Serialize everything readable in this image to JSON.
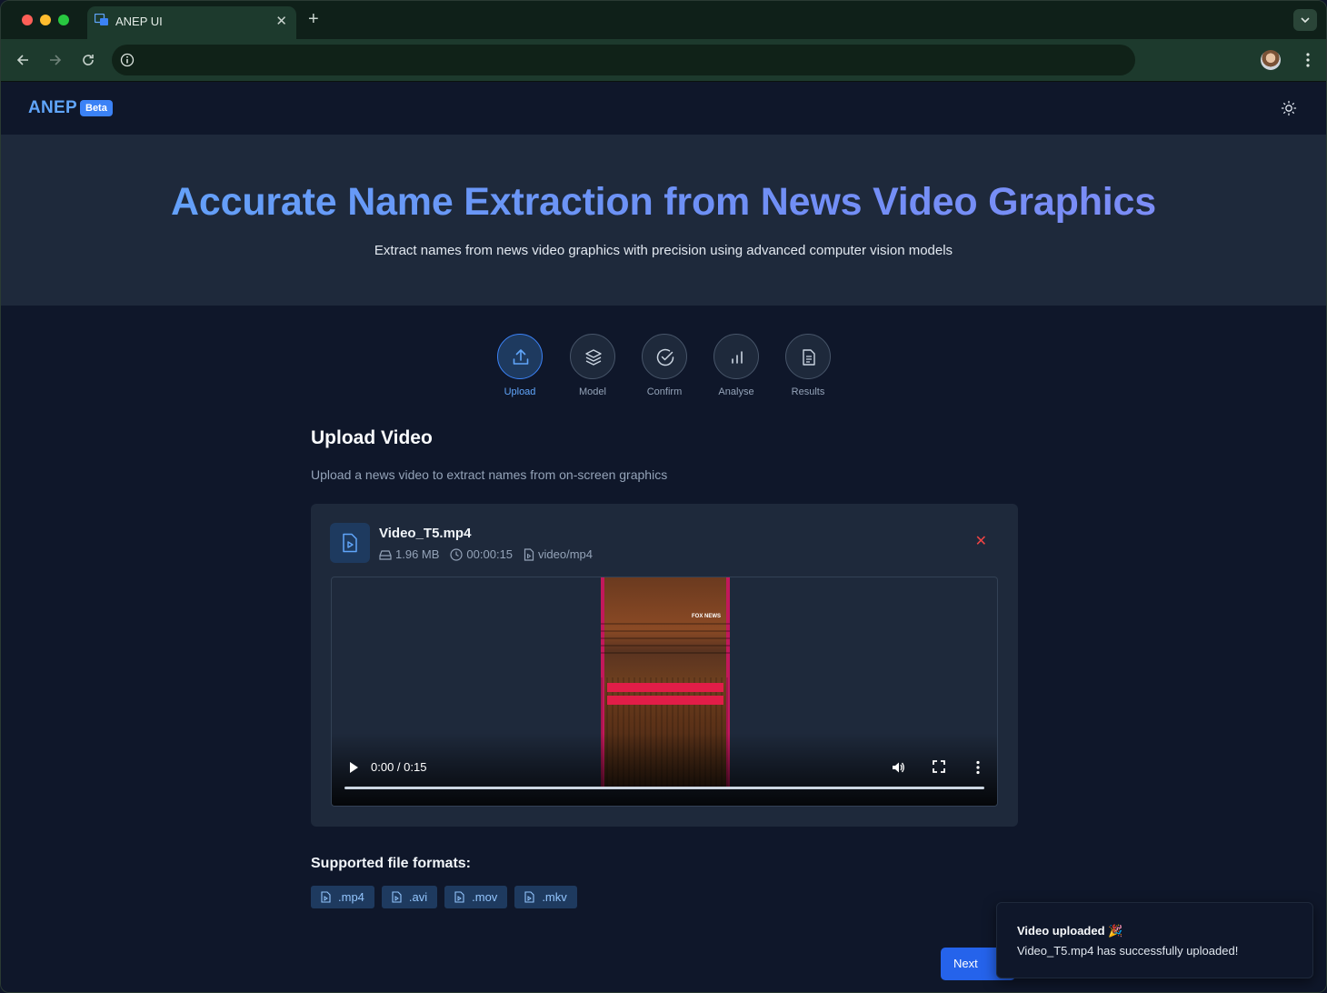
{
  "browser": {
    "tab_title": "ANEP UI",
    "tab_close": "✕",
    "new_tab": "+",
    "url": ""
  },
  "header": {
    "logo": "ANEP",
    "badge": "Beta"
  },
  "hero": {
    "title": "Accurate Name Extraction from News Video Graphics",
    "subtitle": "Extract names from news video graphics with precision using advanced computer vision models"
  },
  "steps": [
    {
      "label": "Upload",
      "icon": "upload-icon",
      "active": true
    },
    {
      "label": "Model",
      "icon": "layers-icon",
      "active": false
    },
    {
      "label": "Confirm",
      "icon": "check-circle-icon",
      "active": false
    },
    {
      "label": "Analyse",
      "icon": "bar-chart-icon",
      "active": false
    },
    {
      "label": "Results",
      "icon": "document-icon",
      "active": false
    }
  ],
  "upload": {
    "title": "Upload Video",
    "subtitle": "Upload a news video to extract names from on-screen graphics"
  },
  "file": {
    "name": "Video_T5.mp4",
    "size": "1.96 MB",
    "duration": "00:00:15",
    "type": "video/mp4",
    "remove": "✕"
  },
  "video": {
    "time": "0:00 / 0:15",
    "watermark": "FOX NEWS",
    "progress": 0
  },
  "formats": {
    "title": "Supported file formats:",
    "items": [
      ".mp4",
      ".avi",
      ".mov",
      ".mkv"
    ]
  },
  "actions": {
    "next": "Next"
  },
  "toast": {
    "title": "Video uploaded 🎉",
    "message": "Video_T5.mp4 has successfully uploaded!"
  },
  "colors": {
    "accent": "#3b82f6",
    "background": "#0f172a",
    "card": "#1e293b",
    "danger": "#ef4444"
  }
}
